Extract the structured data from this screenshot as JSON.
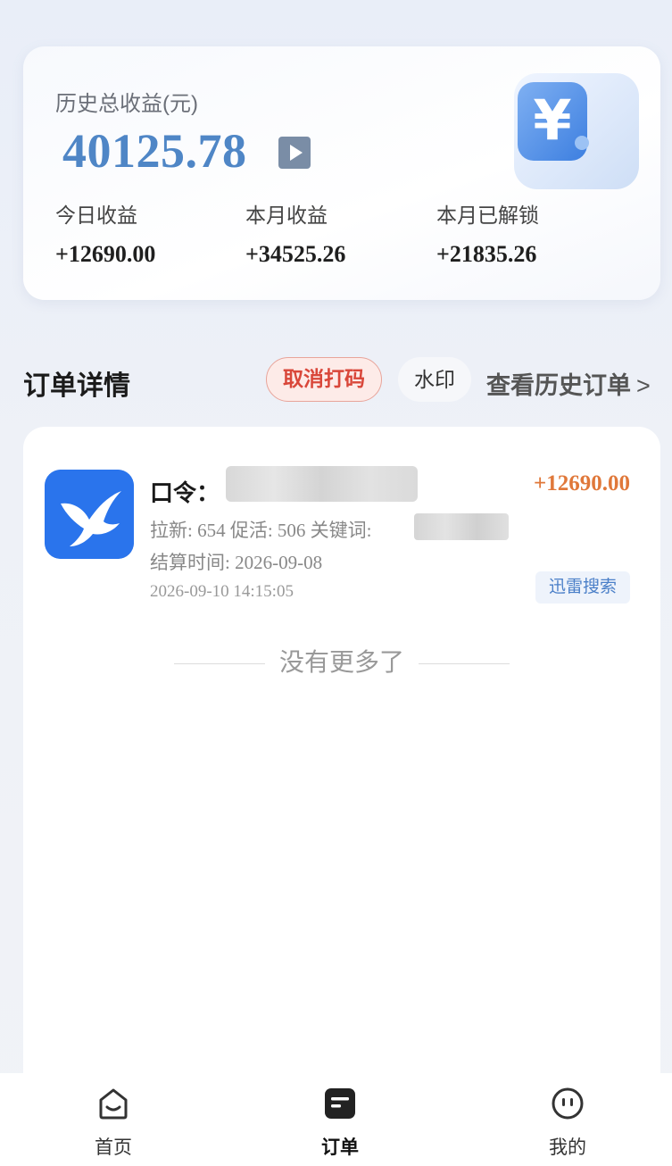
{
  "earnings": {
    "total_label": "历史总收益(元)",
    "total_value": "40125.78",
    "stats": [
      {
        "label": "今日收益",
        "value": "+12690.00"
      },
      {
        "label": "本月收益",
        "value": "+34525.26"
      },
      {
        "label": "本月已解锁",
        "value": "+21835.26"
      }
    ]
  },
  "orders_section": {
    "title": "订单详情",
    "cancel_mask_label": "取消打码",
    "watermark_label": "水印",
    "history_link": "查看历史订单",
    "history_chevron": ">"
  },
  "order": {
    "command_label": "口令：",
    "amount": "+12690.00",
    "stats_text": "拉新: 654 促活: 506 关键词:",
    "settle_text": "结算时间: 2026-09-08",
    "timestamp": "2026-09-10 14:15:05",
    "tag": "迅雷搜索"
  },
  "list_end": "没有更多了",
  "tabbar": {
    "items": [
      {
        "label": "首页"
      },
      {
        "label": "订单"
      },
      {
        "label": "我的"
      }
    ]
  },
  "colors": {
    "accent_blue": "#4f86c6",
    "amount_orange": "#e0783a",
    "cancel_red": "#d9473a"
  }
}
